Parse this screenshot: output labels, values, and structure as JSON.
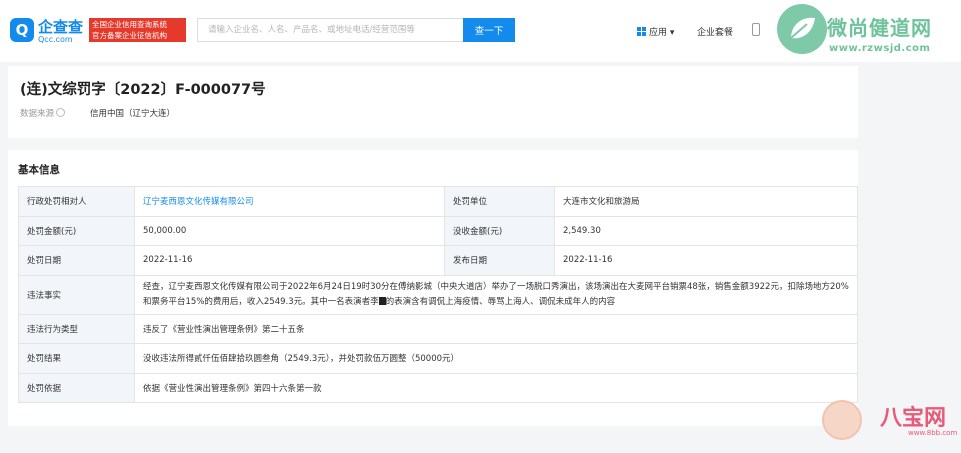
{
  "header": {
    "logo_mark": "Q",
    "logo_name": "企查查",
    "logo_url": "Qcc.com",
    "badge_line1": "全国企业信用查询系统",
    "badge_line2": "官方备案企业征信机构",
    "search_placeholder": "请输入企业名、人名、产品名、或地址电话/经营范围等",
    "search_button": "查一下",
    "nav_apps": "应用",
    "nav_package": "企业套餐"
  },
  "watermark_top": {
    "name": "微尚健道网",
    "url": "www.rzwsjd.com"
  },
  "watermark_bottom": {
    "name": "八宝网",
    "url": "www.8bb.com"
  },
  "document": {
    "title": "(连)文综罚字〔2022〕F-000077号",
    "source_label": "数据来源",
    "source_value": "信用中国（辽宁大连）"
  },
  "basic_info": {
    "section_title": "基本信息",
    "rows": {
      "party_label": "行政处罚相对人",
      "party_value": "辽宁麦西恩文化传媒有限公司",
      "unit_label": "处罚单位",
      "unit_value": "大连市文化和旅游局",
      "amount_label": "处罚金额(元)",
      "amount_value": "50,000.00",
      "confiscated_label": "没收金额(元)",
      "confiscated_value": "2,549.30",
      "date_label": "处罚日期",
      "date_value": "2022-11-16",
      "publish_label": "发布日期",
      "publish_value": "2022-11-16",
      "facts_label": "违法事实",
      "facts_value_a": "经查，辽宁麦西恩文化传媒有限公司于2022年6月24日19时30分在傅纳影城（中央大道店）举办了一场脱口秀演出，该场演出在大麦网平台销票48张，销售金额3922元，扣除场地方20%和票务平台15%的费用后，收入2549.3元。其中一名表演者李",
      "facts_value_b": "的表演含有调侃上海疫情、辱骂上海人、调侃未成年人的内容",
      "type_label": "违法行为类型",
      "type_value": "违反了《营业性演出管理条例》第二十五条",
      "result_label": "处罚结果",
      "result_value": "没收违法所得贰仟伍佰肆拾玖圆叁角（2549.3元），并处罚款伍万圆整（50000元）",
      "basis_label": "处罚依据",
      "basis_value": "依据《营业性演出管理条例》第四十六条第一款"
    }
  }
}
